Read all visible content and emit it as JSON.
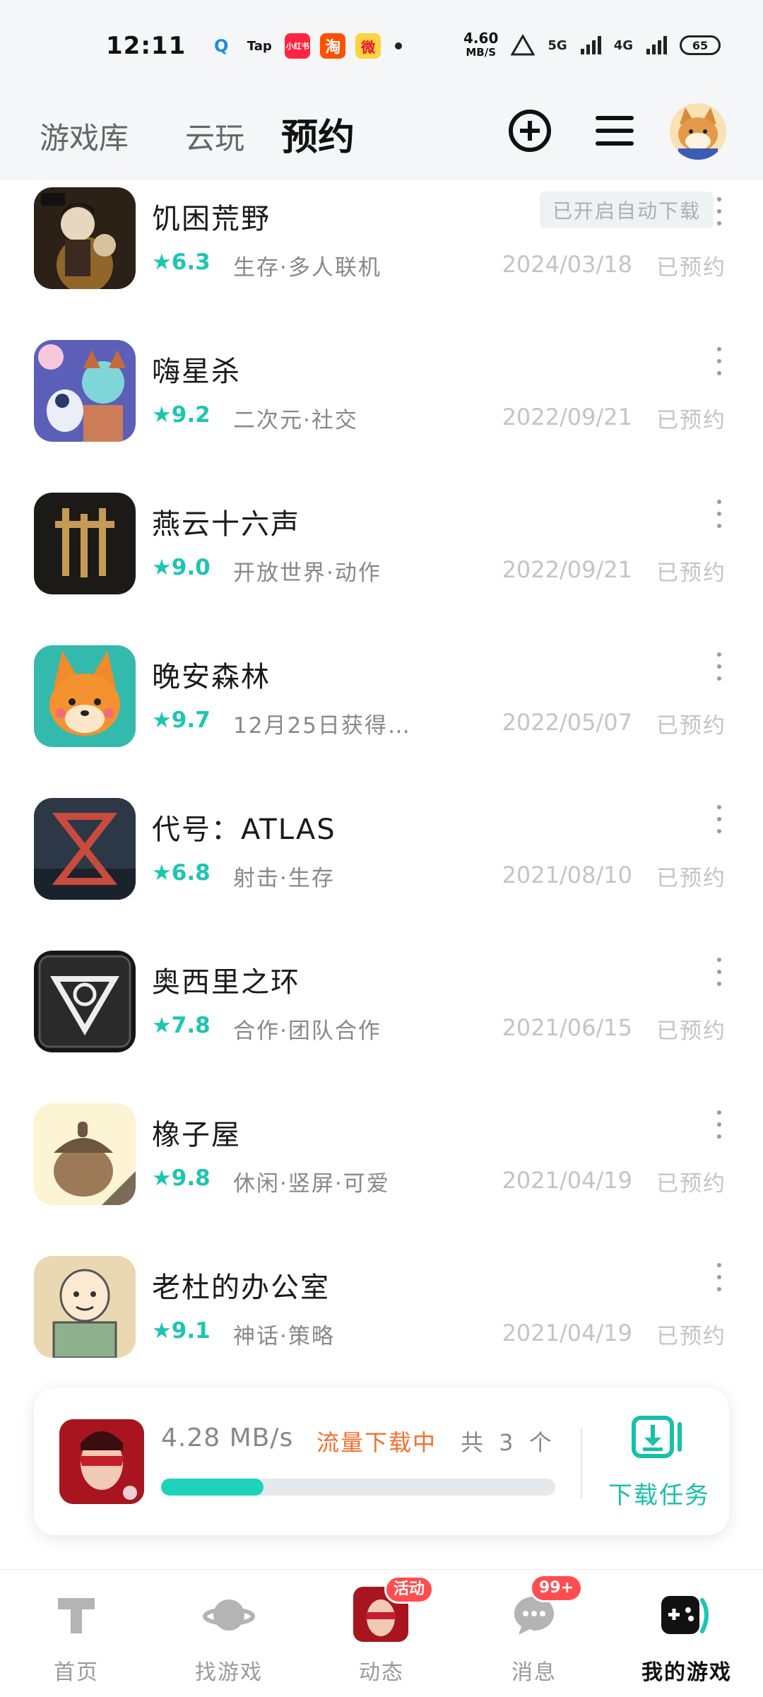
{
  "status_bar": {
    "time": "12:11",
    "apps": [
      {
        "name": "search-app-icon",
        "label": "Q",
        "color": "#ffffff",
        "fg": "#1b8be0"
      },
      {
        "name": "taptap-icon",
        "label": "Tap",
        "color": "#ffffff",
        "fg": "#111111"
      },
      {
        "name": "xiaohongshu-icon",
        "label": "小红书",
        "color": "#ff2442",
        "fg": "#ffffff"
      },
      {
        "name": "taobao-icon",
        "label": "淘",
        "color": "#ff5000",
        "fg": "#ffffff"
      },
      {
        "name": "weibo-icon",
        "label": "微",
        "color": "#ffd23f",
        "fg": "#e6162d"
      }
    ],
    "net_speed": "4.60",
    "net_unit": "MB/S",
    "signal_1": "5G",
    "signal_2": "4G",
    "battery": "65"
  },
  "top_nav": {
    "tabs": [
      {
        "label": "游戏库",
        "active": false
      },
      {
        "label": "云玩",
        "active": false
      },
      {
        "label": "预约",
        "active": true
      }
    ]
  },
  "games": [
    {
      "name": "饥困荒野",
      "rating": "★6.3",
      "tags": "生存·多人联机",
      "date": "2024/03/18",
      "status": "已预约",
      "auto_badge": "已开启自动下载",
      "icon_color": "#3b2a1c"
    },
    {
      "name": "嗨星杀",
      "rating": "★9.2",
      "tags": "二次元·社交",
      "date": "2022/09/21",
      "status": "已预约",
      "auto_badge": "",
      "icon_color": "#6d6bc7"
    },
    {
      "name": "燕云十六声",
      "rating": "★9.0",
      "tags": "开放世界·动作",
      "date": "2022/09/21",
      "status": "已预约",
      "auto_badge": "",
      "icon_color": "#1e1c18"
    },
    {
      "name": "晚安森林",
      "rating": "★9.7",
      "tags": "12月25日获得…",
      "date": "2022/05/07",
      "status": "已预约",
      "auto_badge": "",
      "icon_color": "#3cc2b8"
    },
    {
      "name": "代号：ATLAS",
      "rating": "★6.8",
      "tags": "射击·生存",
      "date": "2021/08/10",
      "status": "已预约",
      "auto_badge": "",
      "icon_color": "#2e3d4c"
    },
    {
      "name": "奥西里之环",
      "rating": "★7.8",
      "tags": "合作·团队合作",
      "date": "2021/06/15",
      "status": "已预约",
      "auto_badge": "",
      "icon_color": "#151515"
    },
    {
      "name": "橡子屋",
      "rating": "★9.8",
      "tags": "休闲·竖屏·可爱",
      "date": "2021/04/19",
      "status": "已预约",
      "auto_badge": "",
      "icon_color": "#fbf3d2"
    },
    {
      "name": "老杜的办公室",
      "rating": "★9.1",
      "tags": "神话·策略",
      "date": "2021/04/19",
      "status": "已预约",
      "auto_badge": "",
      "icon_color": "#e8d6b0"
    }
  ],
  "download": {
    "speed": "4.28 MB/s",
    "state": "流量下载中",
    "count": "共 3 个",
    "progress": 0.26,
    "task_label": "下载任务"
  },
  "bottom_nav": {
    "items": [
      {
        "label": "首页",
        "active": false
      },
      {
        "label": "找游戏",
        "active": false
      },
      {
        "label": "动态",
        "active": false,
        "badge": "活动"
      },
      {
        "label": "消息",
        "active": false,
        "badge": "99+"
      },
      {
        "label": "我的游戏",
        "active": true
      }
    ]
  },
  "colors": {
    "accent": "#1cc6b1",
    "download_state": "#f26f2c",
    "badge": "#ff4d4f"
  }
}
